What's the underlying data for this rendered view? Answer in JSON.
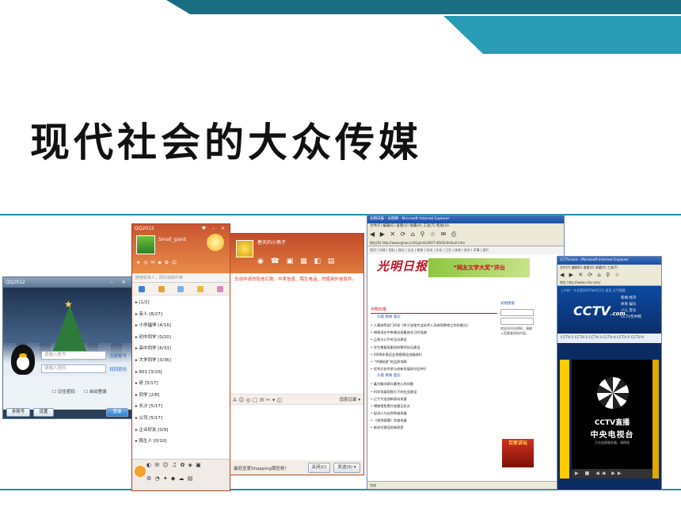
{
  "slide": {
    "title": "现代社会的大众传媒",
    "colors": {
      "accent": "#1d8fa8",
      "band_dark": "#1a6e82",
      "band_light": "#2a9bb4"
    }
  },
  "qq_login": {
    "title": "QQ2012",
    "window_buttons": "–  ×",
    "account_placeholder": "请输入账号",
    "password_placeholder": "请输入密码",
    "register_link": "注册账号",
    "forgot_link": "找回密码",
    "remember_label": "记住密码",
    "autologin_label": "自动登录",
    "multi_account_button": "多账号",
    "settings_button": "设置",
    "login_button": "登录"
  },
  "qq_main": {
    "title": "QQ2012",
    "window_buttons": "♥ –  ×",
    "nickname": "Small_giant",
    "search_placeholder": "搜索联系人，网页或邮件等",
    "groups": [
      "▸ [1/2]",
      "▸ 亲人 [8/27]",
      "▸ 小学福坤 [4/16]",
      "▸ 初中同学 [0/20]",
      "▸ 高中同学 [6/33]",
      "▸ 大学同学 [3/36]",
      "▸ 601 [3/10]",
      "▸ 研 [5/17]",
      "▸ 同学 [2/8]",
      "▸ 长沙 [5/17]",
      "▸ 公司 [5/17]",
      "▸ 企业好友 [0/9]",
      "▸ 陌生人 [0/10]"
    ]
  },
  "qq_chat": {
    "peer_name": "春天的小燕子",
    "notice": "交谈中请勿轻信汇款、中奖信息、陌生电话，勿使用外挂软件。",
    "history_button": "消息记录 ▾",
    "ad_text": "最低至爱Shopping周狂抢！",
    "close_button": "关闭(C)",
    "send_button": "发送(S) ▾"
  },
  "ie_guangming": {
    "window_title": "光明日报 - 光明网 - Microsoft Internet Explorer",
    "menu": "文件(F)  编辑(E)  查看(V)  收藏(A)  工具(T)  帮助(H)",
    "address": "地址(D)  http://www.gmw.cn/01gmrb/2007-06/02/default.htm",
    "nav": "首页 | 时政 | 国际 | 理论 | 法治 | 教育 | 科技 | 文化 | 卫生 | 体育 | 经济 | 军事 | 图片",
    "logo": "光明日报",
    "banner": "“网友文学大奖”评出",
    "column_title": "光明日报",
    "sub_nav": "头版   要闻   理论",
    "headlines": [
      "人事部等部门印发《关于加强专业技术人员继续教育工作的意见》",
      "胡锦涛在中央政治局集体学习时强调",
      "正视与公平的法治建设",
      "学生需要高素质的教师队伍建设",
      "2008年奥运会场馆建设进展顺利",
      "“中国制造”的品质保障",
      "优秀文化传承与创新发展研讨会举行",
      "着力解决群众最关心的问题",
      "科学发展观指引下的社会建设",
      "辽宁大连创新驱动发展",
      "博物馆免费开放惠及民众",
      "促进人与自然和谐发展",
      "《规划纲要》实施进展",
      "新农村建设的新探索"
    ],
    "sidebar_head": "光明搜索",
    "sidebar_text": "欢迎访问光明网，请输入您要查找的内容。",
    "ad": "百家讲坛",
    "status": "完成"
  },
  "ie_cctv": {
    "window_title": "CCTV.com - Microsoft Internet Explorer",
    "menu": "文件(F) 编辑(E) 查看(V) 收藏(A) 工具(T)",
    "address": "地址  http://www.cctv.com/",
    "top_links": "上午好！今天是2007年6月2日  首页  天气预报",
    "logo_main": "CCTV",
    "logo_suffix": ".com",
    "menu_items": [
      "新闻  经济",
      "体育  娱乐",
      "少儿  音乐",
      "CCTV空中网"
    ],
    "channels": "CCTV-1  CCTV-2  CCTV-3  CCTV-4  CCTV-5  CCTV-6",
    "live_logo": "CCTV直播",
    "live_name": "中央电视台",
    "live_sub": "正在连接服务器，请稍候",
    "controls": "▶ ■ ◀◀ ▶▶"
  }
}
